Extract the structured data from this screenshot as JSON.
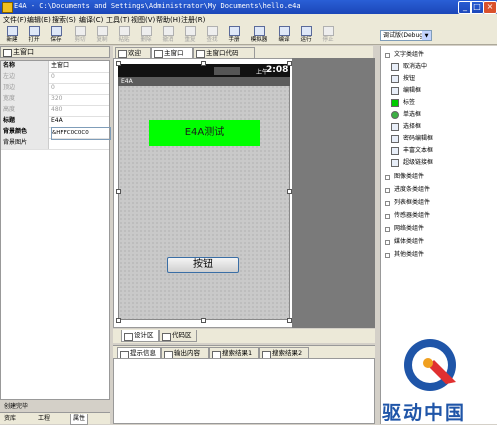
{
  "window": {
    "title": "E4A - C:\\Documents and Settings\\Administrator\\My Documents\\hello.e4a"
  },
  "menu": [
    "文件(F)",
    "编辑(E)",
    "搜索(S)",
    "编译(C)",
    "工具(T)",
    "视图(V)",
    "帮助(H)",
    "注册(R)"
  ],
  "toolbar": {
    "buttons": [
      {
        "label": "新建",
        "enabled": true
      },
      {
        "label": "打开",
        "enabled": true
      },
      {
        "label": "保存",
        "enabled": true
      },
      {
        "label": "剪切",
        "enabled": false
      },
      {
        "label": "复制",
        "enabled": false
      },
      {
        "label": "粘贴",
        "enabled": false
      },
      {
        "label": "删除",
        "enabled": false
      },
      {
        "label": "撤消",
        "enabled": false
      },
      {
        "label": "重复",
        "enabled": false
      },
      {
        "label": "查找",
        "enabled": false
      },
      {
        "label": "手册",
        "enabled": true
      },
      {
        "label": "模拟器",
        "enabled": true
      },
      {
        "label": "编译",
        "enabled": true
      },
      {
        "label": "运行",
        "enabled": true
      },
      {
        "label": "停止",
        "enabled": false
      }
    ],
    "build_mode": "调试版(Debug)"
  },
  "left_panel": {
    "header": "主窗口",
    "properties": [
      {
        "key": "名称",
        "value": "主窗口",
        "key_bold": true,
        "dim": false
      },
      {
        "key": "左边",
        "value": "0",
        "key_bold": false,
        "dim": true
      },
      {
        "key": "顶边",
        "value": "0",
        "key_bold": false,
        "dim": true
      },
      {
        "key": "宽度",
        "value": "320",
        "key_bold": false,
        "dim": true
      },
      {
        "key": "高度",
        "value": "480",
        "key_bold": false,
        "dim": true
      },
      {
        "key": "标题",
        "value": "E4A",
        "key_bold": true,
        "dim": false
      },
      {
        "key": "背景颜色",
        "value": "&HFFC0C0C0",
        "key_bold": true,
        "dim": false
      },
      {
        "key": "背景图片",
        "value": "",
        "key_bold": false,
        "dim": false
      }
    ],
    "status": "创建完毕",
    "tabs": [
      "资库",
      "工程",
      "属性"
    ]
  },
  "doc_tabs": [
    "欢迎",
    "主窗口",
    "主窗口代码"
  ],
  "designer": {
    "status_time_ampm": "上午",
    "status_time": "2:08",
    "app_title": "E4A",
    "label_text": "E4A测试",
    "button_text": "按钮"
  },
  "code_tabs": [
    "设计区",
    "代码区"
  ],
  "bottom_tabs": [
    "提示信息",
    "输出内容",
    "搜索结果1",
    "搜索结果2"
  ],
  "right_panel": {
    "items": [
      {
        "type": "category",
        "label": "文字类组件",
        "expanded": true
      },
      {
        "type": "item",
        "label": "取消选中"
      },
      {
        "type": "item",
        "label": "按钮"
      },
      {
        "type": "item",
        "label": "编辑框"
      },
      {
        "type": "item",
        "label": "标签"
      },
      {
        "type": "item",
        "label": "单选框"
      },
      {
        "type": "item",
        "label": "选择框"
      },
      {
        "type": "item",
        "label": "密码编辑框"
      },
      {
        "type": "item",
        "label": "丰富文本框"
      },
      {
        "type": "item",
        "label": "超级链接框"
      },
      {
        "type": "category",
        "label": "图像类组件",
        "expanded": false
      },
      {
        "type": "category",
        "label": "进度条类组件",
        "expanded": false
      },
      {
        "type": "category",
        "label": "列表框类组件",
        "expanded": false
      },
      {
        "type": "category",
        "label": "传感器类组件",
        "expanded": false
      },
      {
        "type": "category",
        "label": "网络类组件",
        "expanded": false
      },
      {
        "type": "category",
        "label": "媒体类组件",
        "expanded": false
      },
      {
        "type": "category",
        "label": "其他类组件",
        "expanded": false
      }
    ]
  },
  "watermark": {
    "text": "驱动中国"
  },
  "colors": {
    "label_bg": "#00ff00",
    "titlebar": "#2a5fd6",
    "watermark": "#1f55a8"
  }
}
